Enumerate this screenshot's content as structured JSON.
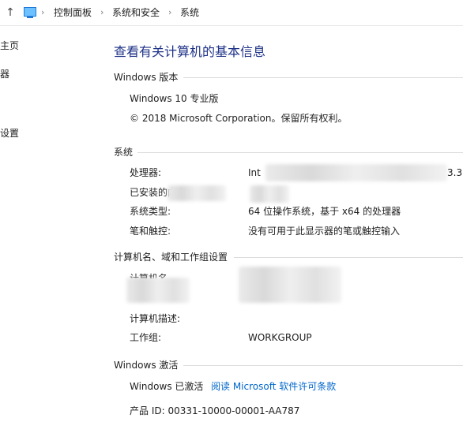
{
  "address_bar": {
    "crumbs": [
      "控制面板",
      "系统和安全",
      "系统"
    ]
  },
  "sidebar": {
    "items": [
      "主页",
      "器",
      "设置"
    ]
  },
  "page": {
    "title": "查看有关计算机的基本信息"
  },
  "windows_edition": {
    "section_title": "Windows 版本",
    "edition": "Windows 10 专业版",
    "copyright": "© 2018 Microsoft Corporation。保留所有权利。"
  },
  "system": {
    "section_title": "系统",
    "processor_label": "处理器:",
    "processor_value": "Int",
    "processor_tail": "3.3",
    "memory_label": "已安装的内存",
    "system_type_label": "系统类型:",
    "system_type_value": "64 位操作系统，基于 x64 的处理器",
    "pen_touch_label": "笔和触控:",
    "pen_touch_value": "没有可用于此显示器的笔或触控输入"
  },
  "computer_name": {
    "section_title": "计算机名、域和工作组设置",
    "computer_name_label": "计算机名",
    "description_label": "计算机描述:",
    "workgroup_label": "工作组:",
    "workgroup_value": "WORKGROUP"
  },
  "activation": {
    "section_title": "Windows 激活",
    "status": "Windows 已激活",
    "license_link": "阅读 Microsoft 软件许可条款",
    "product_id": "产品 ID: 00331-10000-00001-AA787"
  }
}
